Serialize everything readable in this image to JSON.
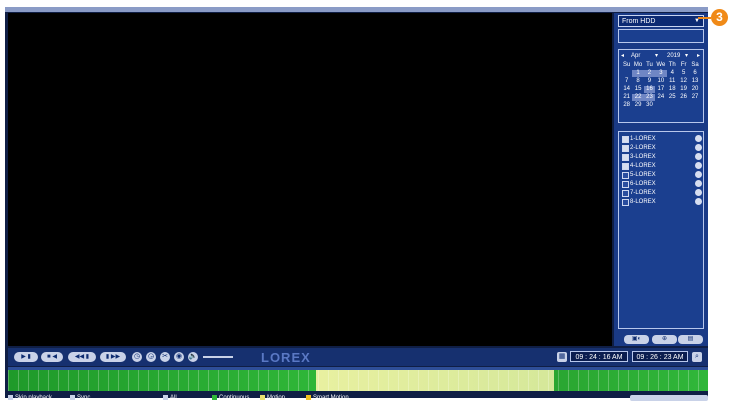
{
  "source_select": {
    "value": "From HDD"
  },
  "calendar": {
    "month": "Apr",
    "year": "2019",
    "weekdays": [
      "Su",
      "Mo",
      "Tu",
      "We",
      "Th",
      "Fr",
      "Sa"
    ],
    "days": [
      "",
      "1",
      "2",
      "3",
      "4",
      "5",
      "6",
      "7",
      "8",
      "9",
      "10",
      "11",
      "12",
      "13",
      "14",
      "15",
      "16",
      "17",
      "18",
      "19",
      "20",
      "21",
      "22",
      "23",
      "24",
      "25",
      "26",
      "27",
      "28",
      "29",
      "30"
    ],
    "recorded_days": [
      "1",
      "2",
      "3",
      "16",
      "22",
      "23"
    ]
  },
  "channels": [
    "1-LOREX",
    "2-LOREX",
    "3-LOREX",
    "4-LOREX",
    "5-LOREX",
    "6-LOREX",
    "7-LOREX",
    "8-LOREX"
  ],
  "channels_checked": [
    true,
    true,
    true,
    true,
    false,
    false,
    false,
    false
  ],
  "controls": {
    "logo": "LOREX",
    "start_time": "09 : 24 : 16 AM",
    "end_time": "09 : 26 : 23 AM"
  },
  "legend": {
    "skip_playback": "Skip playback",
    "sync": "Sync",
    "all": "All",
    "continuous": "Continuous",
    "motion": "Motion",
    "smart_motion": "Smart Motion"
  },
  "callout": "3",
  "colors": {
    "panel_bg": "#1a3a86",
    "continuous": "#2fb638",
    "motion": "#e8f0a0",
    "callout": "#f08a18"
  }
}
